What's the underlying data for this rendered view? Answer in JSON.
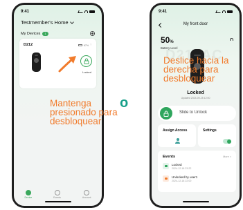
{
  "left_phone": {
    "time": "9:41",
    "home_title": "Testmember's Home",
    "my_devices_label": "My Devices",
    "device_count": "1",
    "device": {
      "name": "D212",
      "battery": "67%",
      "state": "Locked"
    },
    "tabs": [
      {
        "label": "Device",
        "active": true
      },
      {
        "label": "Events",
        "active": false
      },
      {
        "label": "Account",
        "active": false
      }
    ]
  },
  "left_instruction": "Mantenga presionado para desbloquear",
  "or_word": "o",
  "right_phone": {
    "time": "9:41",
    "title": "My front door",
    "battery_value": "50",
    "battery_unit": "%",
    "battery_label": "Battery Level",
    "watermark": "D212AC",
    "lock_state": "Locked",
    "updated": "Updated 2024-09-25 12:00",
    "slide_text": "Slide to Unlock",
    "assign_access": "Assign Access",
    "settings": "Settings",
    "events": {
      "title": "Events",
      "more": "More >",
      "items": [
        {
          "name": "Locked",
          "date": "2024-12-18 23:22"
        },
        {
          "name": "Unlocked by user1",
          "date": "2024-12-18 22:00"
        }
      ]
    }
  },
  "right_instruction": "Deslice hacia la derecha para desbloquear",
  "colors": {
    "accent_green": "#2fa65d",
    "instruction_orange": "#f17b2c",
    "or_teal": "#18a08a"
  }
}
